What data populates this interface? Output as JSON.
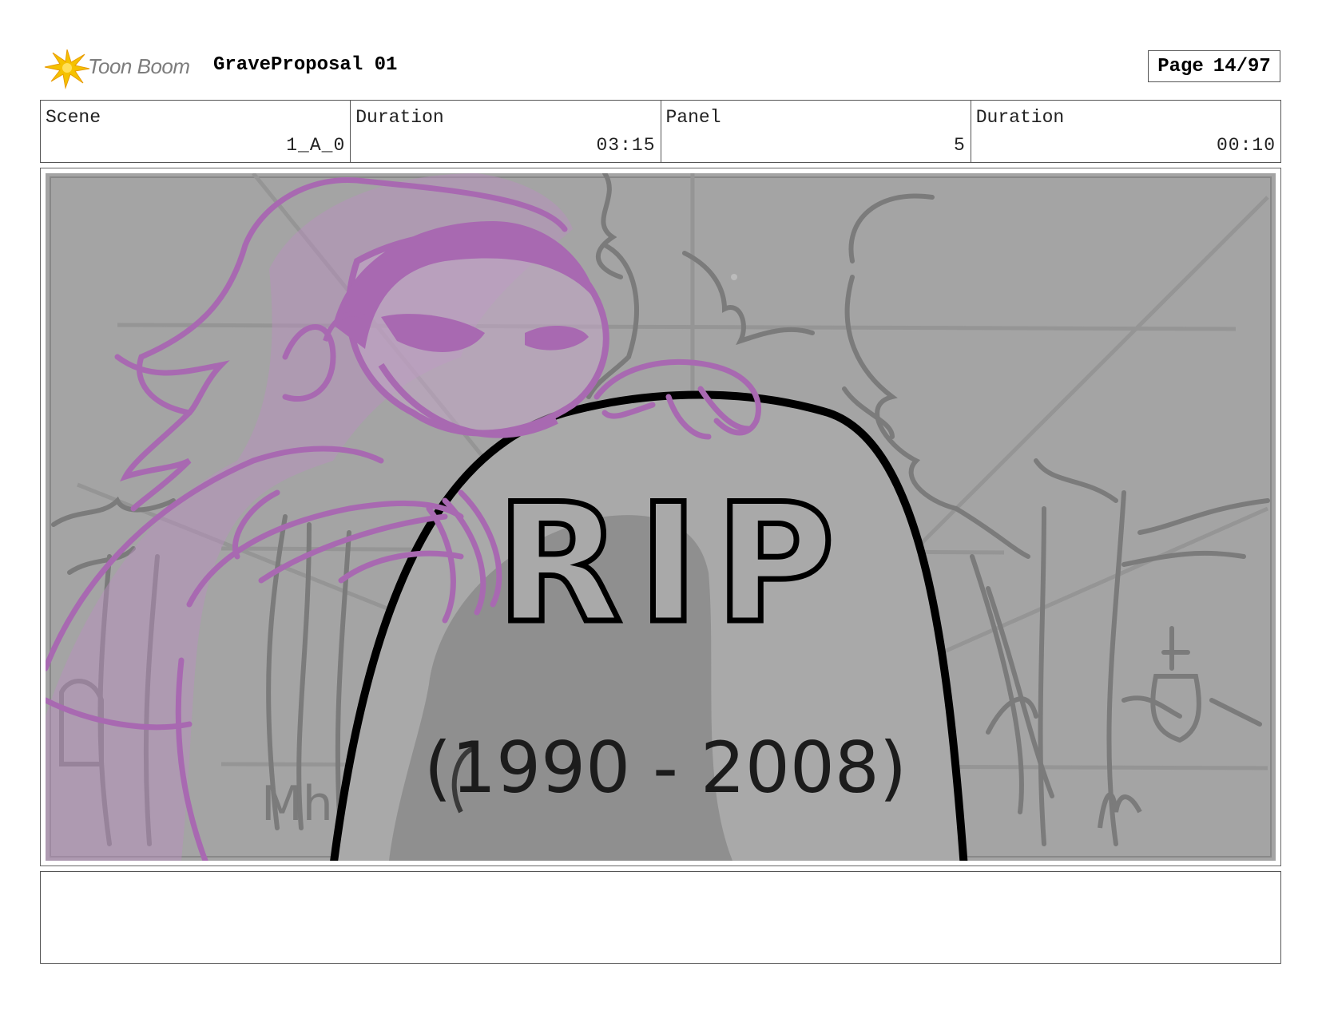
{
  "header": {
    "logo_text": "Toon Boom",
    "project_title": "GraveProposal 01",
    "page_label": "Page",
    "page_number": "14/97"
  },
  "info": {
    "scene_label": "Scene",
    "scene_value": "1_A_0",
    "scene_duration_label": "Duration",
    "scene_duration_value": "03:15",
    "panel_label": "Panel",
    "panel_value": "5",
    "panel_duration_label": "Duration",
    "panel_duration_value": "00:10"
  },
  "panel": {
    "tombstone_inscription": "RIP",
    "tombstone_dates": "(1990 - 2008)",
    "ground_scribble": "Mhn",
    "colors": {
      "background": "#a4a4a4",
      "ghost_figure": "#a869b1",
      "tombstone_outline": "#000000",
      "scenery_lines": "#7b7b7b"
    }
  },
  "notes": {
    "text": ""
  }
}
